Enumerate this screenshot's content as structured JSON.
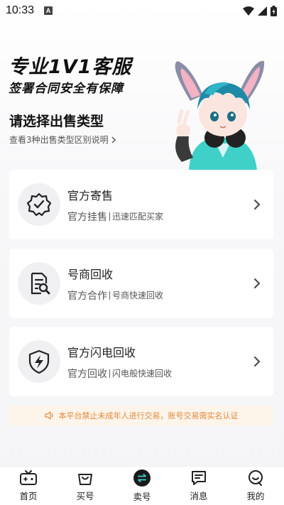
{
  "status_bar": {
    "time": "10:33",
    "notif_letter": "A"
  },
  "hero": {
    "title": "专业1V1客服",
    "subtitle": "签署合同安全有保障"
  },
  "section": {
    "title": "请选择出售类型",
    "explain_link": "查看3种出售类型区别说明"
  },
  "cards": [
    {
      "title": "官方寄售",
      "desc_main": "官方挂售",
      "desc_sub": "迅速匹配买家",
      "icon": "verified-badge-icon"
    },
    {
      "title": "号商回收",
      "desc_main": "官方合作",
      "desc_sub": "号商快速回收",
      "icon": "document-search-icon"
    },
    {
      "title": "官方闪电回收",
      "desc_main": "官方回收",
      "desc_sub": "闪电般快速回收",
      "icon": "lightning-shield-icon"
    }
  ],
  "notice": {
    "text": "本平台禁止未成年人进行交易，账号交易需实名认证"
  },
  "bottom_nav": [
    {
      "label": "首页",
      "icon": "home-game-icon"
    },
    {
      "label": "买号",
      "icon": "shopping-bag-icon"
    },
    {
      "label": "卖号",
      "icon": "sell-exchange-icon"
    },
    {
      "label": "消息",
      "icon": "message-icon"
    },
    {
      "label": "我的",
      "icon": "profile-icon"
    }
  ],
  "colors": {
    "notice_text": "#e08a3c",
    "notice_bg": "#fdf4ea",
    "accent_teal": "#3fd0c8"
  }
}
